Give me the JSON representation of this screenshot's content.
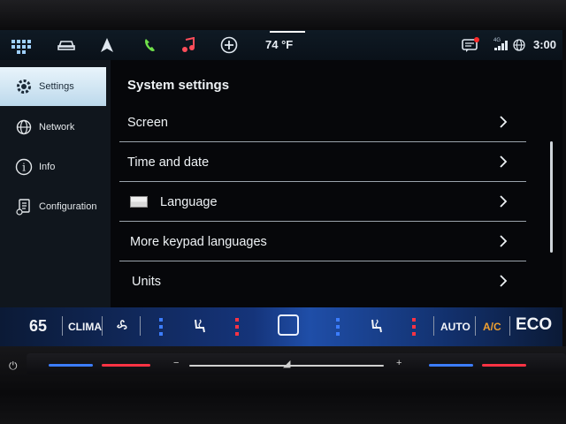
{
  "statusbar": {
    "temperature": "74 °F",
    "time": "3:00",
    "network_label": "4G"
  },
  "sidebar": {
    "items": [
      {
        "label": "Settings",
        "icon": "gear-icon",
        "active": true
      },
      {
        "label": "Network",
        "icon": "globe-icon",
        "active": false
      },
      {
        "label": "Info",
        "icon": "info-icon",
        "active": false
      },
      {
        "label": "Configuration",
        "icon": "clipboard-icon",
        "active": false
      }
    ]
  },
  "main": {
    "title": "System settings",
    "rows": [
      {
        "label": "Screen"
      },
      {
        "label": "Time and date"
      },
      {
        "label": "Language",
        "icon": "flag-icon"
      },
      {
        "label": "More keypad languages"
      },
      {
        "label": "Units"
      }
    ]
  },
  "clima": {
    "temperature": "65",
    "label": "CLIMA",
    "auto": "AUTO",
    "ac": "A/C",
    "eco": "ECO"
  },
  "colors": {
    "accent": "#9fd0ff",
    "music": "#ff4d5a",
    "phone": "#6fe04a",
    "ac": "#f0a030",
    "notification": "#ff2a2a"
  }
}
